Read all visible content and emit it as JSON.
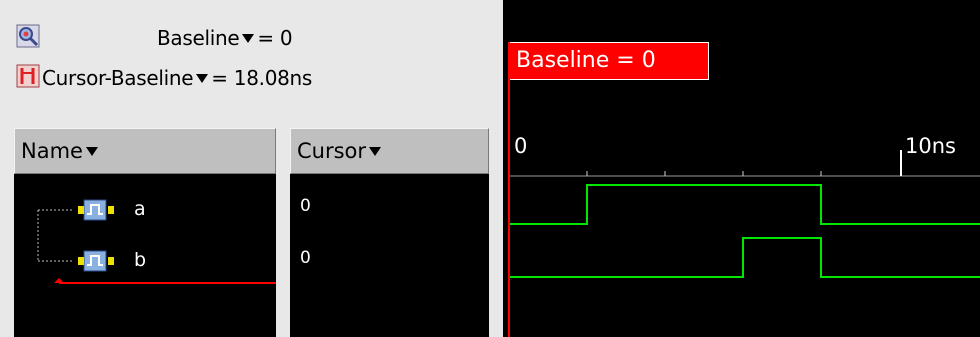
{
  "toolbar": {
    "baseline_label": "Baseline",
    "baseline_value": "= 0",
    "cursor_baseline_label": "Cursor-Baseline",
    "cursor_baseline_value": "= 18.08ns",
    "zoom_icon": "magnify-zoom-icon",
    "baseline_icon": "cursor-baseline-icon"
  },
  "columns": {
    "name_header": "Name",
    "cursor_header": "Cursor"
  },
  "signals": [
    {
      "name": "a",
      "cursor_value": "0",
      "icon": "signal-waveform-icon"
    },
    {
      "name": "b",
      "cursor_value": "0",
      "icon": "signal-waveform-icon"
    }
  ],
  "waveform": {
    "baseline_tag": "Baseline = 0",
    "time_labels": [
      "0",
      "10ns"
    ],
    "colors": {
      "background": "#000000",
      "wave": "#00e600",
      "baseline": "#ff0000",
      "header": "#bfbfbf"
    }
  }
}
